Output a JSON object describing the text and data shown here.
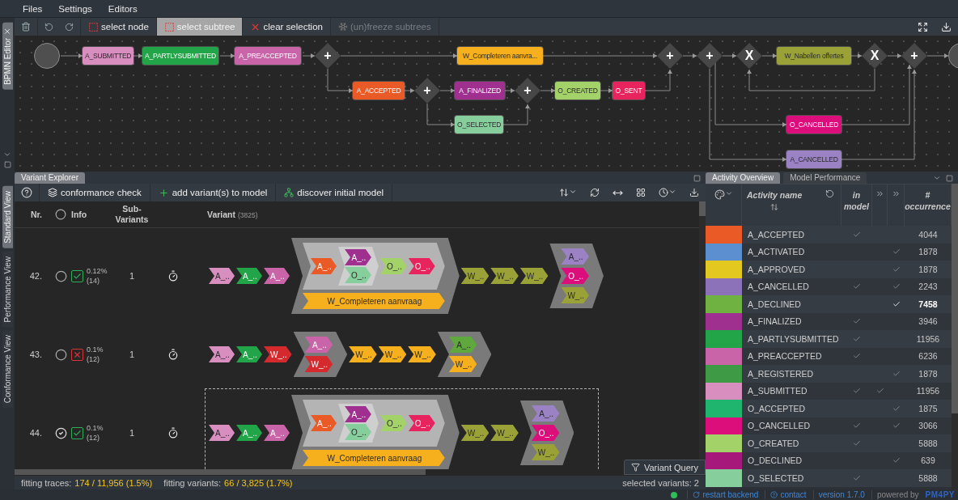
{
  "menu": [
    "Files",
    "Settings",
    "Editors"
  ],
  "bpmn": {
    "tab": "BPMN Editor",
    "toolbar": [
      {
        "kind": "select",
        "label": "select node",
        "selected": false,
        "disabled": false
      },
      {
        "kind": "select",
        "label": "select subtree",
        "selected": true,
        "disabled": false
      },
      {
        "kind": "clear",
        "label": "clear selection",
        "selected": false,
        "disabled": false
      },
      {
        "kind": "freeze",
        "label": "(un)freeze subtrees",
        "selected": false,
        "disabled": true
      }
    ],
    "nodes": [
      {
        "kind": "task",
        "label": "A_SUBMITTED",
        "color": "#d88fc0"
      },
      {
        "kind": "task",
        "label": "A_PARTLYSUBMITTED",
        "color": "#22a548"
      },
      {
        "kind": "task",
        "label": "A_PREACCEPTED",
        "color": "#c964a8"
      },
      {
        "kind": "gateway",
        "symbol": "+"
      },
      {
        "kind": "task",
        "label": "W_Completeren aanvra...",
        "color": "#f6b01e"
      },
      {
        "kind": "gateway",
        "symbol": "+"
      },
      {
        "kind": "gateway",
        "symbol": "+"
      },
      {
        "kind": "gateway",
        "symbol": "X"
      },
      {
        "kind": "task",
        "label": "W_Nabellen offertes",
        "color": "#9aa237"
      },
      {
        "kind": "gateway",
        "symbol": "X"
      },
      {
        "kind": "gateway",
        "symbol": "+"
      },
      {
        "kind": "task",
        "label": "A_ACCEPTED",
        "color": "#e95a26"
      },
      {
        "kind": "gateway",
        "symbol": "+"
      },
      {
        "kind": "task",
        "label": "A_FINALIZED",
        "color": "#a0308f"
      },
      {
        "kind": "gateway",
        "symbol": "+"
      },
      {
        "kind": "task",
        "label": "O_CREATED",
        "color": "#a3d269"
      },
      {
        "kind": "task",
        "label": "O_SENT",
        "color": "#e8245f"
      },
      {
        "kind": "task",
        "label": "O_SELECTED",
        "color": "#86cf9c"
      },
      {
        "kind": "task",
        "label": "O_CANCELLED",
        "color": "#dc0e7b"
      },
      {
        "kind": "task",
        "label": "A_CANCELLED",
        "color": "#9a82c4"
      }
    ]
  },
  "variant_explorer": {
    "tab": "Variant Explorer",
    "view_tabs": [
      {
        "label": "Standard View",
        "selected": true
      },
      {
        "label": "Performance View",
        "selected": false
      },
      {
        "label": "Conformance View",
        "selected": false
      }
    ],
    "toolbar": [
      {
        "kind": "conformance",
        "label": "conformance check"
      },
      {
        "kind": "add",
        "label": "add variant(s) to model"
      },
      {
        "kind": "discover",
        "label": "discover initial model"
      }
    ],
    "columns": {
      "nr": "Nr.",
      "info": "Info",
      "subvariants": "Sub-Variants",
      "variant": "Variant",
      "variant_count": "(3825)"
    },
    "rows": [
      {
        "nr": "42.",
        "selected": false,
        "fitting": true,
        "percent": "0.12%",
        "count": "(14)",
        "subvariants": "1",
        "variant": [
          {
            "kind": "activity",
            "label": "A_..",
            "color": "#d88fc0"
          },
          {
            "kind": "activity",
            "label": "A_..",
            "color": "#22a548"
          },
          {
            "kind": "activity",
            "label": "A_..",
            "color": "#c964a8"
          },
          {
            "kind": "parallel",
            "branches": [
              [
                {
                  "kind": "sequence",
                  "items": [
                    {
                      "kind": "activity",
                      "label": "A_..",
                      "color": "#e95a26"
                    },
                    {
                      "kind": "parallel",
                      "branches": [
                        [
                          {
                            "kind": "activity",
                            "label": "A_..",
                            "color": "#a0308f"
                          }
                        ],
                        [
                          {
                            "kind": "activity",
                            "label": "O_..",
                            "color": "#86cf9c"
                          }
                        ]
                      ]
                    },
                    {
                      "kind": "activity",
                      "label": "O_..",
                      "color": "#a3d269"
                    },
                    {
                      "kind": "activity",
                      "label": "O_..",
                      "color": "#e8245f"
                    }
                  ]
                }
              ],
              [
                {
                  "kind": "activity",
                  "label": "W_Completeren aanvraag",
                  "color": "#f6b01e"
                }
              ]
            ]
          },
          {
            "kind": "activity",
            "label": "W_..",
            "color": "#9aa237"
          },
          {
            "kind": "activity",
            "label": "W_..",
            "color": "#9aa237"
          },
          {
            "kind": "activity",
            "label": "W_..",
            "color": "#9aa237"
          },
          {
            "kind": "parallel",
            "branches": [
              [
                {
                  "kind": "activity",
                  "label": "A_..",
                  "color": "#9a82c4"
                }
              ],
              [
                {
                  "kind": "activity",
                  "label": "O_..",
                  "color": "#dc0e7b"
                }
              ],
              [
                {
                  "kind": "activity",
                  "label": "W_..",
                  "color": "#9aa237"
                }
              ]
            ]
          }
        ]
      },
      {
        "nr": "43.",
        "selected": false,
        "fitting": false,
        "percent": "0.1%",
        "count": "(12)",
        "subvariants": "1",
        "variant": [
          {
            "kind": "activity",
            "label": "A_..",
            "color": "#d88fc0"
          },
          {
            "kind": "activity",
            "label": "A_..",
            "color": "#22a548"
          },
          {
            "kind": "activity",
            "label": "W_..",
            "color": "#d42a2e"
          },
          {
            "kind": "parallel",
            "branches": [
              [
                {
                  "kind": "activity",
                  "label": "A_..",
                  "color": "#c964a8"
                }
              ],
              [
                {
                  "kind": "activity",
                  "label": "W_..",
                  "color": "#d42a2e"
                }
              ]
            ]
          },
          {
            "kind": "activity",
            "label": "W_..",
            "color": "#f6b01e"
          },
          {
            "kind": "activity",
            "label": "W_..",
            "color": "#f6b01e"
          },
          {
            "kind": "activity",
            "label": "W_..",
            "color": "#f6b01e"
          },
          {
            "kind": "parallel",
            "branches": [
              [
                {
                  "kind": "activity",
                  "label": "A_..",
                  "color": "#5fa83d"
                }
              ],
              [
                {
                  "kind": "activity",
                  "label": "W_..",
                  "color": "#f6b01e"
                }
              ]
            ]
          }
        ]
      },
      {
        "nr": "44.",
        "selected": true,
        "fitting": true,
        "percent": "0.1%",
        "count": "(12)",
        "subvariants": "1",
        "variant": [
          {
            "kind": "activity",
            "label": "A_..",
            "color": "#d88fc0"
          },
          {
            "kind": "activity",
            "label": "A_..",
            "color": "#22a548"
          },
          {
            "kind": "activity",
            "label": "A_..",
            "color": "#c964a8"
          },
          {
            "kind": "parallel",
            "branches": [
              [
                {
                  "kind": "sequence",
                  "items": [
                    {
                      "kind": "activity",
                      "label": "A_..",
                      "color": "#e95a26"
                    },
                    {
                      "kind": "parallel",
                      "branches": [
                        [
                          {
                            "kind": "activity",
                            "label": "A_..",
                            "color": "#a0308f"
                          }
                        ],
                        [
                          {
                            "kind": "activity",
                            "label": "O_..",
                            "color": "#86cf9c"
                          }
                        ]
                      ]
                    },
                    {
                      "kind": "activity",
                      "label": "O_..",
                      "color": "#a3d269"
                    },
                    {
                      "kind": "activity",
                      "label": "O_..",
                      "color": "#e8245f"
                    }
                  ]
                }
              ],
              [
                {
                  "kind": "activity",
                  "label": "W_Completeren aanvraag",
                  "color": "#f6b01e"
                }
              ]
            ]
          },
          {
            "kind": "activity",
            "label": "W_..",
            "color": "#9aa237"
          },
          {
            "kind": "activity",
            "label": "W_..",
            "color": "#9aa237"
          },
          {
            "kind": "parallel",
            "branches": [
              [
                {
                  "kind": "activity",
                  "label": "A_..",
                  "color": "#9a82c4"
                }
              ],
              [
                {
                  "kind": "activity",
                  "label": "O_..",
                  "color": "#dc0e7b"
                }
              ],
              [
                {
                  "kind": "activity",
                  "label": "W_..",
                  "color": "#9aa237"
                }
              ]
            ]
          }
        ]
      }
    ],
    "query_button": "Variant Query",
    "status": {
      "fitting_traces": {
        "label": "fitting traces:",
        "value": "174 / 11,956 (1.5%)"
      },
      "fitting_variants": {
        "label": "fitting variants:",
        "value": "66 / 3,825 (1.7%)"
      },
      "selected_variants": "selected variants: 2"
    }
  },
  "activity_overview": {
    "tabs": [
      {
        "label": "Activity Overview",
        "selected": true
      },
      {
        "label": "Model Performance",
        "selected": false
      }
    ],
    "columns": {
      "name": "Activity name",
      "in_model": "in model",
      "occurrence": "# occurrence"
    },
    "rows": [
      {
        "color": "#e95a26",
        "name": "A_ACCEPTED",
        "in_model": true,
        "col_4": false,
        "col_5": false,
        "occurrence": "4044",
        "highlighted": false
      },
      {
        "color": "#5b8fd0",
        "name": "A_ACTIVATED",
        "in_model": false,
        "col_4": false,
        "col_5": true,
        "occurrence": "1878",
        "highlighted": false
      },
      {
        "color": "#e2c81f",
        "name": "A_APPROVED",
        "in_model": false,
        "col_4": false,
        "col_5": true,
        "occurrence": "1878",
        "highlighted": false
      },
      {
        "color": "#8c72b8",
        "name": "A_CANCELLED",
        "in_model": true,
        "col_4": false,
        "col_5": true,
        "occurrence": "2243",
        "highlighted": false
      },
      {
        "color": "#6fb241",
        "name": "A_DECLINED",
        "in_model": false,
        "col_4": false,
        "col_5": true,
        "occurrence": "7458",
        "highlighted": true
      },
      {
        "color": "#a0308f",
        "name": "A_FINALIZED",
        "in_model": true,
        "col_4": false,
        "col_5": false,
        "occurrence": "3946",
        "highlighted": false
      },
      {
        "color": "#22a548",
        "name": "A_PARTLYSUBMITTED",
        "in_model": true,
        "col_4": false,
        "col_5": false,
        "occurrence": "11956",
        "highlighted": false
      },
      {
        "color": "#c964a8",
        "name": "A_PREACCEPTED",
        "in_model": true,
        "col_4": false,
        "col_5": false,
        "occurrence": "6236",
        "highlighted": false
      },
      {
        "color": "#3f9a45",
        "name": "A_REGISTERED",
        "in_model": false,
        "col_4": false,
        "col_5": true,
        "occurrence": "1878",
        "highlighted": false
      },
      {
        "color": "#d88fc0",
        "name": "A_SUBMITTED",
        "in_model": true,
        "col_4": true,
        "col_5": false,
        "occurrence": "11956",
        "highlighted": false
      },
      {
        "color": "#1fb56e",
        "name": "O_ACCEPTED",
        "in_model": false,
        "col_4": false,
        "col_5": true,
        "occurrence": "1875",
        "highlighted": false
      },
      {
        "color": "#dc0e7b",
        "name": "O_CANCELLED",
        "in_model": true,
        "col_4": false,
        "col_5": true,
        "occurrence": "3066",
        "highlighted": false
      },
      {
        "color": "#a3d269",
        "name": "O_CREATED",
        "in_model": true,
        "col_4": false,
        "col_5": false,
        "occurrence": "5888",
        "highlighted": false
      },
      {
        "color": "#a6197a",
        "name": "O_DECLINED",
        "in_model": false,
        "col_4": false,
        "col_5": true,
        "occurrence": "639",
        "highlighted": false
      },
      {
        "color": "#86cf9c",
        "name": "O_SELECTED",
        "in_model": true,
        "col_4": false,
        "col_5": false,
        "occurrence": "5888",
        "highlighted": false
      }
    ]
  },
  "footer": {
    "restart": "restart backend",
    "contact": "contact",
    "version": "version 1.7.0",
    "powered_by": "powered by",
    "logo": "PM4PY"
  }
}
